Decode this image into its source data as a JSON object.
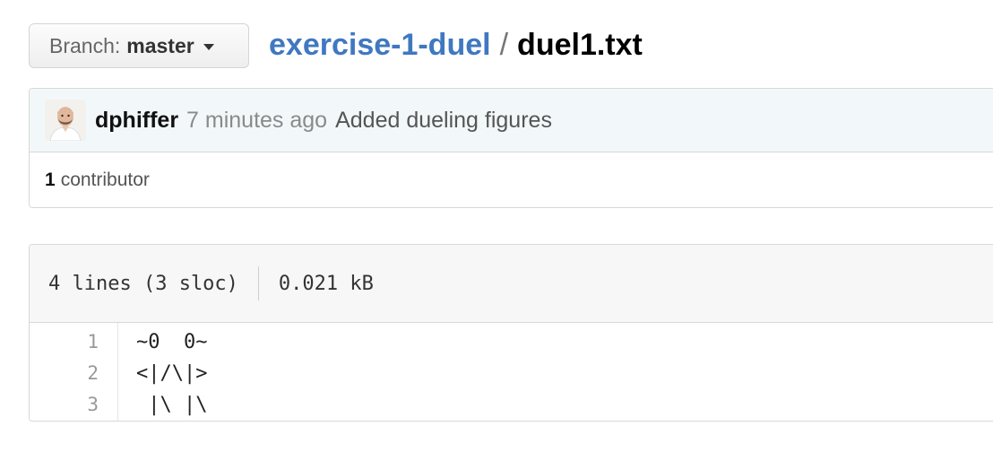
{
  "branch": {
    "prefix": "Branch:",
    "name": "master",
    "icon": "caret-down-icon"
  },
  "breadcrumb": {
    "repo": "exercise-1-duel",
    "separator": "/",
    "file": "duel1.txt"
  },
  "commit": {
    "avatar_icon": "user-avatar",
    "author": "dphiffer",
    "time": "7 minutes ago",
    "message": "Added dueling figures"
  },
  "contributors": {
    "count": "1",
    "label": "contributor"
  },
  "file": {
    "lines_info": "4 lines (3 sloc)",
    "size": "0.021 kB",
    "lines": [
      {
        "num": "1",
        "text": "~0  0~"
      },
      {
        "num": "2",
        "text": "<|/\\|>"
      },
      {
        "num": "3",
        "text": " |\\ |\\"
      }
    ]
  },
  "colors": {
    "link": "#4078c0",
    "commit_bg": "#f2f8fa",
    "header_bg": "#f7f7f7",
    "border": "#d8d8d8"
  }
}
